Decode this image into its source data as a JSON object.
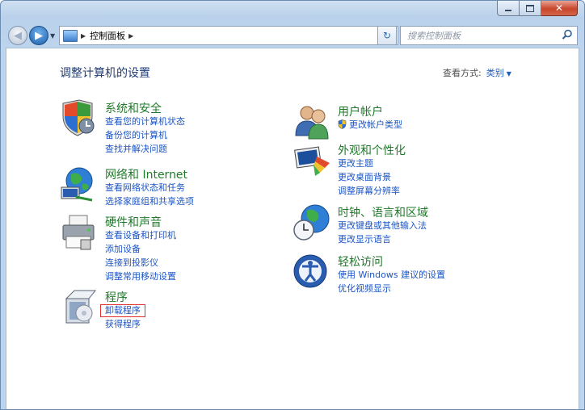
{
  "window": {
    "caption": {
      "minimize": "—",
      "maximize": "□",
      "close": "✕"
    }
  },
  "nav": {
    "breadcrumb": "控制面板",
    "search_placeholder": "搜索控制面板"
  },
  "main": {
    "title": "调整计算机的设置",
    "view_by_label": "查看方式:",
    "view_by_value": "类别"
  },
  "categories": {
    "system_security": {
      "heading": "系统和安全",
      "links": [
        "查看您的计算机状态",
        "备份您的计算机",
        "查找并解决问题"
      ]
    },
    "network": {
      "heading": "网络和 Internet",
      "links": [
        "查看网络状态和任务",
        "选择家庭组和共享选项"
      ]
    },
    "hardware": {
      "heading": "硬件和声音",
      "links": [
        "查看设备和打印机",
        "添加设备",
        "连接到投影仪",
        "调整常用移动设置"
      ]
    },
    "programs": {
      "heading": "程序",
      "links": [
        "卸载程序",
        "获得程序"
      ]
    },
    "user_accounts": {
      "heading": "用户帐户",
      "links": [
        "更改帐户类型"
      ]
    },
    "appearance": {
      "heading": "外观和个性化",
      "links": [
        "更改主题",
        "更改桌面背景",
        "调整屏幕分辨率"
      ]
    },
    "clock_region": {
      "heading": "时钟、语言和区域",
      "links": [
        "更改键盘或其他输入法",
        "更改显示语言"
      ]
    },
    "ease_access": {
      "heading": "轻松访问",
      "links": [
        "使用 Windows 建议的设置",
        "优化视频显示"
      ]
    }
  },
  "colors": {
    "heading_green": "#1f7a2a",
    "link_blue": "#1a55c7",
    "title_blue": "#1f3b75",
    "highlight_red": "#e03131"
  }
}
